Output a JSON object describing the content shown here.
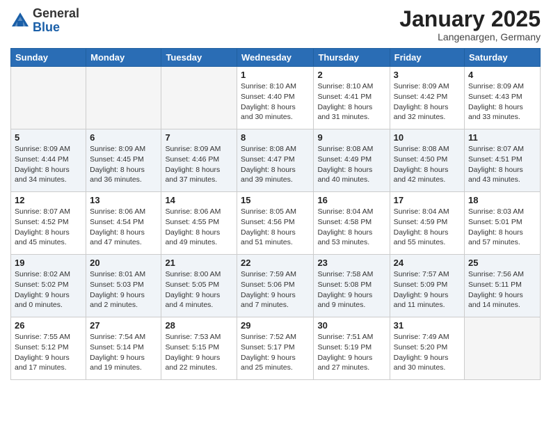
{
  "header": {
    "logo_general": "General",
    "logo_blue": "Blue",
    "month_title": "January 2025",
    "location": "Langenargen, Germany"
  },
  "days_of_week": [
    "Sunday",
    "Monday",
    "Tuesday",
    "Wednesday",
    "Thursday",
    "Friday",
    "Saturday"
  ],
  "weeks": [
    [
      {
        "day": "",
        "info": ""
      },
      {
        "day": "",
        "info": ""
      },
      {
        "day": "",
        "info": ""
      },
      {
        "day": "1",
        "info": "Sunrise: 8:10 AM\nSunset: 4:40 PM\nDaylight: 8 hours\nand 30 minutes."
      },
      {
        "day": "2",
        "info": "Sunrise: 8:10 AM\nSunset: 4:41 PM\nDaylight: 8 hours\nand 31 minutes."
      },
      {
        "day": "3",
        "info": "Sunrise: 8:09 AM\nSunset: 4:42 PM\nDaylight: 8 hours\nand 32 minutes."
      },
      {
        "day": "4",
        "info": "Sunrise: 8:09 AM\nSunset: 4:43 PM\nDaylight: 8 hours\nand 33 minutes."
      }
    ],
    [
      {
        "day": "5",
        "info": "Sunrise: 8:09 AM\nSunset: 4:44 PM\nDaylight: 8 hours\nand 34 minutes."
      },
      {
        "day": "6",
        "info": "Sunrise: 8:09 AM\nSunset: 4:45 PM\nDaylight: 8 hours\nand 36 minutes."
      },
      {
        "day": "7",
        "info": "Sunrise: 8:09 AM\nSunset: 4:46 PM\nDaylight: 8 hours\nand 37 minutes."
      },
      {
        "day": "8",
        "info": "Sunrise: 8:08 AM\nSunset: 4:47 PM\nDaylight: 8 hours\nand 39 minutes."
      },
      {
        "day": "9",
        "info": "Sunrise: 8:08 AM\nSunset: 4:49 PM\nDaylight: 8 hours\nand 40 minutes."
      },
      {
        "day": "10",
        "info": "Sunrise: 8:08 AM\nSunset: 4:50 PM\nDaylight: 8 hours\nand 42 minutes."
      },
      {
        "day": "11",
        "info": "Sunrise: 8:07 AM\nSunset: 4:51 PM\nDaylight: 8 hours\nand 43 minutes."
      }
    ],
    [
      {
        "day": "12",
        "info": "Sunrise: 8:07 AM\nSunset: 4:52 PM\nDaylight: 8 hours\nand 45 minutes."
      },
      {
        "day": "13",
        "info": "Sunrise: 8:06 AM\nSunset: 4:54 PM\nDaylight: 8 hours\nand 47 minutes."
      },
      {
        "day": "14",
        "info": "Sunrise: 8:06 AM\nSunset: 4:55 PM\nDaylight: 8 hours\nand 49 minutes."
      },
      {
        "day": "15",
        "info": "Sunrise: 8:05 AM\nSunset: 4:56 PM\nDaylight: 8 hours\nand 51 minutes."
      },
      {
        "day": "16",
        "info": "Sunrise: 8:04 AM\nSunset: 4:58 PM\nDaylight: 8 hours\nand 53 minutes."
      },
      {
        "day": "17",
        "info": "Sunrise: 8:04 AM\nSunset: 4:59 PM\nDaylight: 8 hours\nand 55 minutes."
      },
      {
        "day": "18",
        "info": "Sunrise: 8:03 AM\nSunset: 5:01 PM\nDaylight: 8 hours\nand 57 minutes."
      }
    ],
    [
      {
        "day": "19",
        "info": "Sunrise: 8:02 AM\nSunset: 5:02 PM\nDaylight: 9 hours\nand 0 minutes."
      },
      {
        "day": "20",
        "info": "Sunrise: 8:01 AM\nSunset: 5:03 PM\nDaylight: 9 hours\nand 2 minutes."
      },
      {
        "day": "21",
        "info": "Sunrise: 8:00 AM\nSunset: 5:05 PM\nDaylight: 9 hours\nand 4 minutes."
      },
      {
        "day": "22",
        "info": "Sunrise: 7:59 AM\nSunset: 5:06 PM\nDaylight: 9 hours\nand 7 minutes."
      },
      {
        "day": "23",
        "info": "Sunrise: 7:58 AM\nSunset: 5:08 PM\nDaylight: 9 hours\nand 9 minutes."
      },
      {
        "day": "24",
        "info": "Sunrise: 7:57 AM\nSunset: 5:09 PM\nDaylight: 9 hours\nand 11 minutes."
      },
      {
        "day": "25",
        "info": "Sunrise: 7:56 AM\nSunset: 5:11 PM\nDaylight: 9 hours\nand 14 minutes."
      }
    ],
    [
      {
        "day": "26",
        "info": "Sunrise: 7:55 AM\nSunset: 5:12 PM\nDaylight: 9 hours\nand 17 minutes."
      },
      {
        "day": "27",
        "info": "Sunrise: 7:54 AM\nSunset: 5:14 PM\nDaylight: 9 hours\nand 19 minutes."
      },
      {
        "day": "28",
        "info": "Sunrise: 7:53 AM\nSunset: 5:15 PM\nDaylight: 9 hours\nand 22 minutes."
      },
      {
        "day": "29",
        "info": "Sunrise: 7:52 AM\nSunset: 5:17 PM\nDaylight: 9 hours\nand 25 minutes."
      },
      {
        "day": "30",
        "info": "Sunrise: 7:51 AM\nSunset: 5:19 PM\nDaylight: 9 hours\nand 27 minutes."
      },
      {
        "day": "31",
        "info": "Sunrise: 7:49 AM\nSunset: 5:20 PM\nDaylight: 9 hours\nand 30 minutes."
      },
      {
        "day": "",
        "info": ""
      }
    ]
  ]
}
